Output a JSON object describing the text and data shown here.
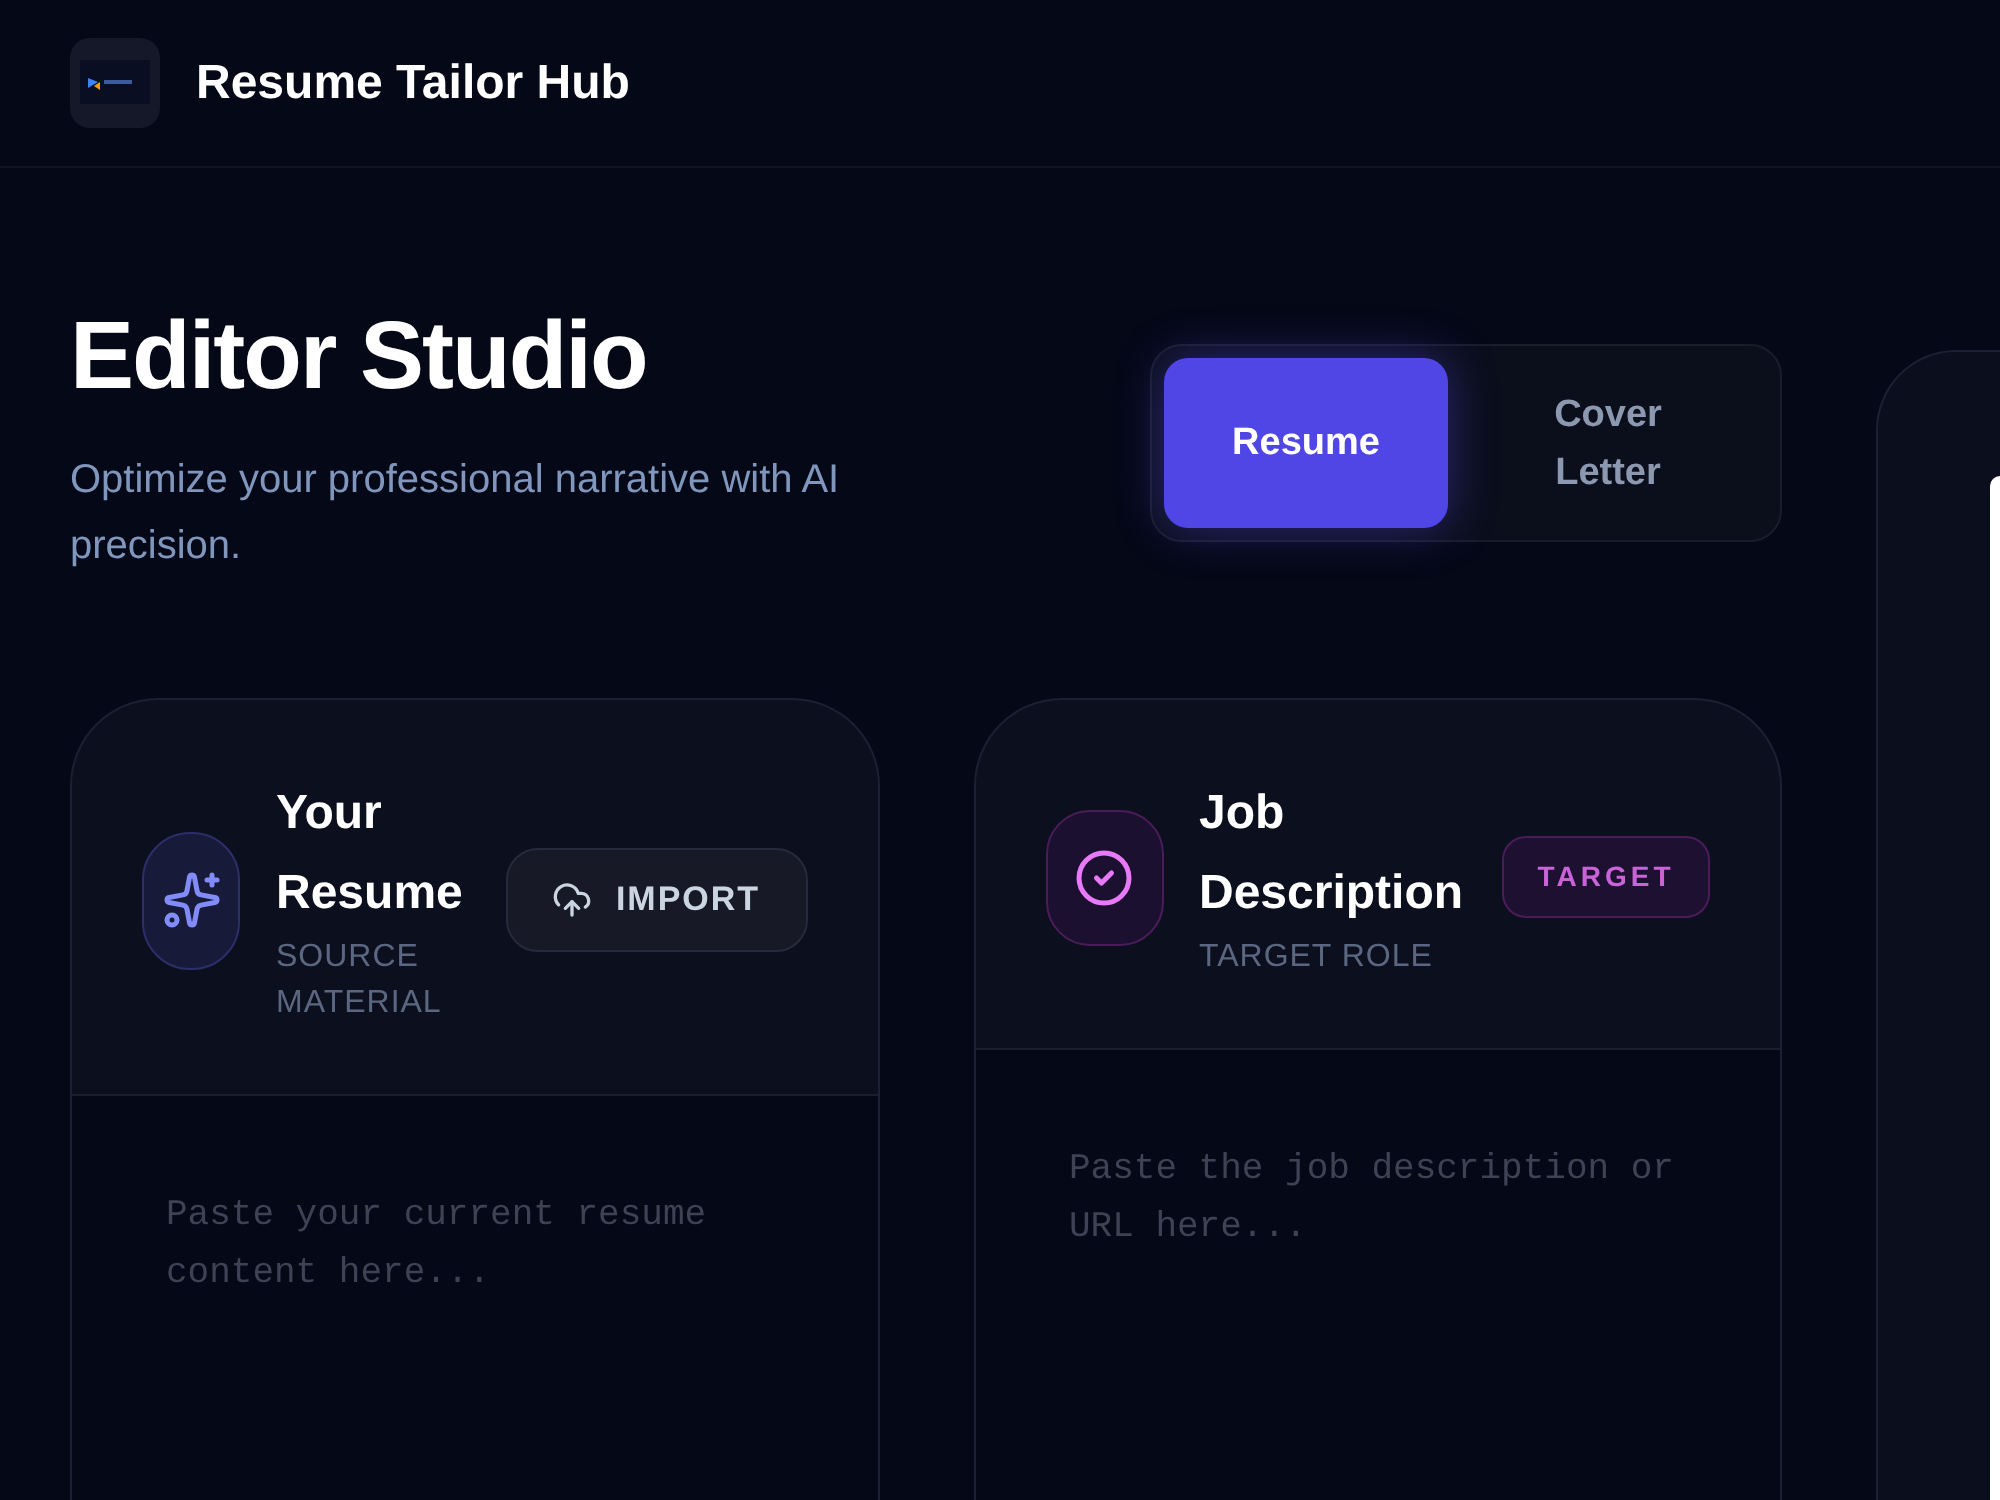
{
  "header": {
    "title": "Resume Tailor Hub"
  },
  "page": {
    "title": "Editor Studio",
    "subtitle": "Optimize your professional narrative with AI precision."
  },
  "mode_tabs": [
    {
      "label": "Resume",
      "selected": true
    },
    {
      "label": "Cover Letter",
      "selected": false
    }
  ],
  "cards": [
    {
      "kind": "resume",
      "title": "Your Resume",
      "subtitle": "SOURCE MATERIAL",
      "action": {
        "kind": "button",
        "label": "IMPORT"
      },
      "input": {
        "placeholder": "Paste your current resume content here..."
      }
    },
    {
      "kind": "job",
      "title": "Job Description",
      "subtitle": "TARGET ROLE",
      "action": {
        "kind": "badge",
        "label": "TARGET"
      },
      "input": {
        "placeholder": "Paste the job description or URL here..."
      }
    }
  ]
}
